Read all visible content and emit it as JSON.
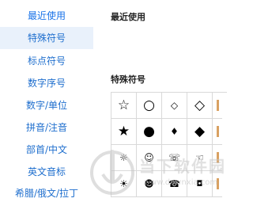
{
  "sidebar": {
    "items": [
      {
        "label": "最近使用"
      },
      {
        "label": "特殊符号"
      },
      {
        "label": "标点符号"
      },
      {
        "label": "数字序号"
      },
      {
        "label": "数字/单位"
      },
      {
        "label": "拼音/注音"
      },
      {
        "label": "部首/中文"
      },
      {
        "label": "英文音标"
      },
      {
        "label": "希腊/俄文/拉丁"
      }
    ]
  },
  "main": {
    "recent_title": "最近使用",
    "special_title": "特殊符号",
    "symbols": [
      [
        "☆",
        "○",
        "◇",
        "◇"
      ],
      [
        "★",
        "●",
        "♦",
        "◆"
      ],
      [
        "☼",
        "☺",
        "☏",
        "☜"
      ],
      [
        "☀",
        "☻",
        "☎",
        "◘"
      ]
    ]
  },
  "watermark": {
    "brand": "当下软件园",
    "url": "www.downxia.com"
  }
}
